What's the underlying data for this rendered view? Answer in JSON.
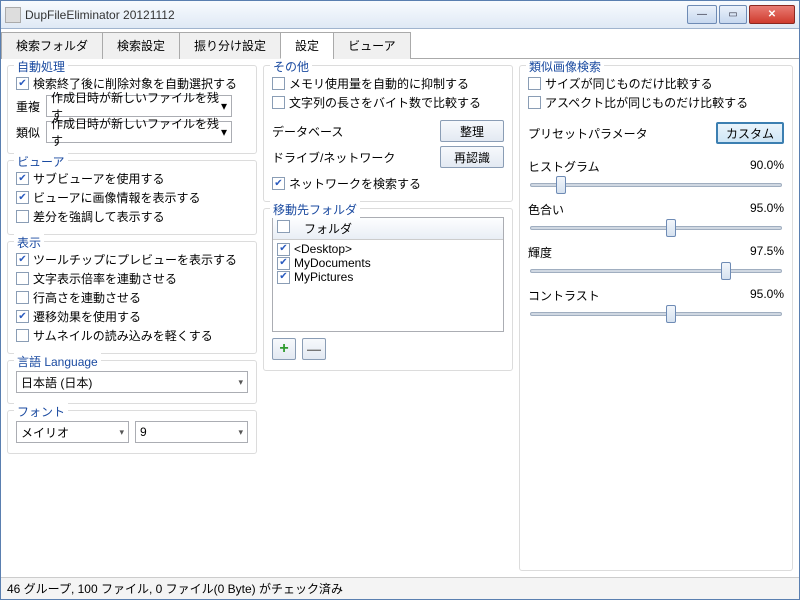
{
  "window": {
    "title": "DupFileEliminator 20121112"
  },
  "tabs": [
    "検索フォルダ",
    "検索設定",
    "振り分け設定",
    "設定",
    "ビューア"
  ],
  "active_tab": 3,
  "auto": {
    "title": "自動処理",
    "check1": "検索終了後に削除対象を自動選択する",
    "dup_label": "重複",
    "dup_value": "作成日時が新しいファイルを残す",
    "sim_label": "類似",
    "sim_value": "作成日時が新しいファイルを残す"
  },
  "viewer": {
    "title": "ビューア",
    "c1": "サブビューアを使用する",
    "c2": "ビューアに画像情報を表示する",
    "c3": "差分を強調して表示する"
  },
  "display": {
    "title": "表示",
    "c1": "ツールチップにプレビューを表示する",
    "c2": "文字表示倍率を連動させる",
    "c3": "行高さを連動させる",
    "c4": "遷移効果を使用する",
    "c5": "サムネイルの読み込みを軽くする"
  },
  "language": {
    "title": "言語 Language",
    "value": "日本語 (日本)"
  },
  "font": {
    "title": "フォント",
    "name": "メイリオ",
    "size": "9"
  },
  "other": {
    "title": "その他",
    "c1": "メモリ使用量を自動的に抑制する",
    "c2": "文字列の長さをバイト数で比較する",
    "db_label": "データベース",
    "db_btn": "整理",
    "net_label": "ドライブ/ネットワーク",
    "net_btn": "再認識",
    "c3": "ネットワークを検索する"
  },
  "movedest": {
    "title": "移動先フォルダ",
    "col": "フォルダ",
    "items": [
      "<Desktop>",
      "MyDocuments",
      "MyPictures"
    ]
  },
  "similar": {
    "title": "類似画像検索",
    "c1": "サイズが同じものだけ比較する",
    "c2": "アスペクト比が同じものだけ比較する",
    "preset_label": "プリセットパラメータ",
    "preset_btn": "カスタム",
    "s1_label": "ヒストグラム",
    "s1_value": "90.0%",
    "s2_label": "色合い",
    "s2_value": "95.0%",
    "s3_label": "輝度",
    "s3_value": "97.5%",
    "s4_label": "コントラスト",
    "s4_value": "95.0%"
  },
  "status": "46 グループ, 100 ファイル, 0 ファイル(0 Byte) がチェック済み"
}
